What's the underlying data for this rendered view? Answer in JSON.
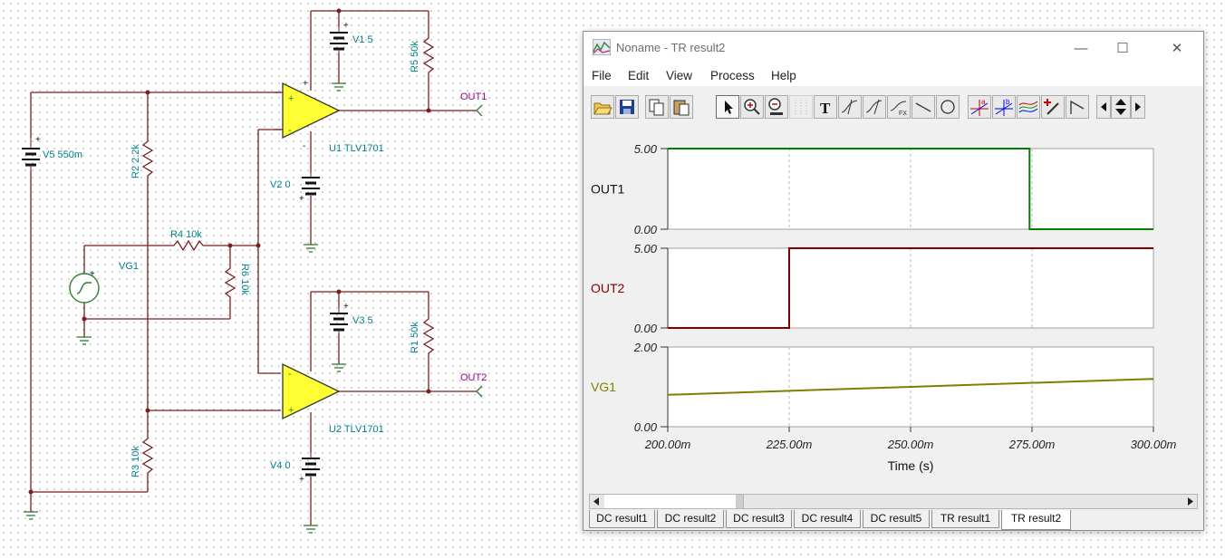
{
  "schematic": {
    "components": {
      "v5": "V5 550m",
      "r2": "R2 2.2k",
      "r3": "R3 10k",
      "r4": "R4 10k",
      "r6": "R6 10k",
      "vg1": "VG1",
      "v1": "V1 5",
      "r5": "R5 50k",
      "u1": "U1 TLV1701",
      "v2": "V2 0",
      "v3": "V3 5",
      "r1": "R1 50k",
      "u2": "U2 TLV1701",
      "v4": "V4 0"
    },
    "nets": {
      "out1": "OUT1",
      "out2": "OUT2"
    },
    "plus": "+",
    "minus": "-"
  },
  "window": {
    "title": "Noname - TR result2",
    "controls": {
      "minimize": "—",
      "maximize": "☐",
      "close": "✕"
    },
    "menu": [
      "File",
      "Edit",
      "View",
      "Process",
      "Help"
    ],
    "tabs": [
      "DC result1",
      "DC result2",
      "DC result3",
      "DC result4",
      "DC result5",
      "TR result1",
      "TR result2"
    ],
    "active_tab": "TR result2"
  },
  "colors": {
    "wire": "#7a1f1f",
    "opamp_fill": "#ffff33",
    "out1": "#008000",
    "out2": "#800000",
    "vg1": "#808000",
    "label": "#00828c",
    "net": "#9a0089"
  },
  "chart_data": {
    "type": "line",
    "xlabel": "Time (s)",
    "x_ticks": [
      "200.00m",
      "225.00m",
      "250.00m",
      "275.00m",
      "300.00m"
    ],
    "xlim": [
      0.2,
      0.3
    ],
    "panels": [
      {
        "name": "OUT1",
        "ylim": [
          0,
          5
        ],
        "y_ticks": [
          "5.00",
          "0.00"
        ],
        "x": [
          0.2,
          0.2745,
          0.2745,
          0.3
        ],
        "y": [
          5,
          5,
          0,
          0
        ]
      },
      {
        "name": "OUT2",
        "ylim": [
          0,
          5
        ],
        "y_ticks": [
          "5.00",
          "0.00"
        ],
        "x": [
          0.2,
          0.225,
          0.225,
          0.3
        ],
        "y": [
          0,
          0,
          5,
          5
        ]
      },
      {
        "name": "VG1",
        "ylim": [
          0,
          2
        ],
        "y_ticks": [
          "2.00",
          "0.00"
        ],
        "x": [
          0.2,
          0.3
        ],
        "y": [
          0.8,
          1.2
        ]
      }
    ]
  }
}
